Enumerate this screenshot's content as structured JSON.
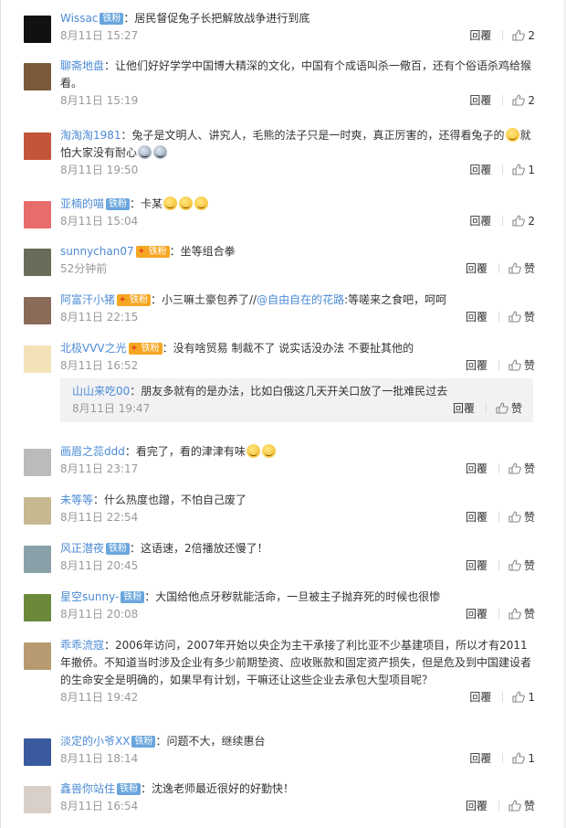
{
  "reply_label": "回覆",
  "comments": [
    {
      "user": "Wissac",
      "badge": "铁粉",
      "vip": "",
      "text": "：居民督促兔子长把解放战争进行到底",
      "time": "8月11日 15:27",
      "likes": "2",
      "avatar": "#111111",
      "emoji": "",
      "emoji_type": "",
      "text2": ""
    },
    {
      "user": "聊斋地盘",
      "badge": "",
      "vip": "",
      "text": "：让他们好好学学中国博大精深的文化，中国有个成语叫杀一儆百，还有个俗语杀鸡给猴看。",
      "time": "8月11日 15:19",
      "likes": "2",
      "avatar": "#7a5a3a",
      "emoji": "",
      "emoji_type": "",
      "text2": ""
    },
    {
      "user": "淘淘淘1981",
      "badge": "",
      "vip": "",
      "text": "：兔子是文明人、讲究人，毛熊的法子只是一时爽，真正厉害的，还得看兔子的",
      "time": "8月11日 19:50",
      "likes": "1",
      "avatar": "#c2553a",
      "emoji": "😊",
      "emoji_type": "smile",
      "text2": "就怕大家没有耐心",
      "emoji2": "😱😱"
    },
    {
      "user": "亚楠的喵",
      "badge": "铁粉",
      "vip": "",
      "text": "：卡某",
      "time": "8月11日 15:04",
      "likes": "2",
      "avatar": "#e86c6c",
      "emoji": "😊😊😊",
      "emoji_type": "smile",
      "text2": ""
    },
    {
      "user": "sunnychan07",
      "badge": "",
      "vip": "铁粉",
      "text": "：坐等组合拳",
      "time": "52分钟前",
      "likes": "",
      "avatar": "#6b6b5a",
      "emoji": "",
      "emoji_type": "",
      "text2": ""
    },
    {
      "user": "阿富汗小猪",
      "badge": "",
      "vip": "铁粉",
      "text": "：小三嘛土豪包养了//",
      "mention": "@自由自在的花路",
      "text_after": ":等嗟来之食吧，呵呵",
      "time": "8月11日 22:15",
      "likes": "",
      "avatar": "#8a6a58",
      "emoji": "",
      "emoji_type": "",
      "text2": ""
    },
    {
      "user": "北极VVV之光",
      "badge": "",
      "vip": "铁粉",
      "text": "：没有啥贸易 制裁不了 说实话没办法 不要扯其他的",
      "time": "8月11日 16:52",
      "likes": "",
      "avatar": "#f3e2b8",
      "emoji": "",
      "emoji_type": "",
      "text2": ""
    }
  ],
  "sub_reply": {
    "user": "山山来吃00",
    "text": "：朋友多就有的是办法，比如白俄这几天开关口放了一批难民过去",
    "time": "8月11日 19:47",
    "likes": ""
  },
  "comments2": [
    {
      "user": "画眉之蕊ddd",
      "badge": "",
      "vip": "",
      "text": "：看完了，看的津津有味",
      "time": "8月11日 23:17",
      "likes": "",
      "avatar": "#bbbbbb",
      "emoji": "😆😆",
      "emoji_type": "laugh",
      "text2": ""
    },
    {
      "user": "未等等",
      "badge": "",
      "vip": "",
      "text": "：什么热度也蹭，不怕自己废了",
      "time": "8月11日 22:54",
      "likes": "",
      "avatar": "#c8b890",
      "emoji": "",
      "emoji_type": "",
      "text2": ""
    },
    {
      "user": "风正潜夜",
      "badge": "铁粉",
      "vip": "",
      "text": "：这语速，2倍播放还慢了！",
      "time": "8月11日 20:45",
      "likes": "",
      "avatar": "#8aa0a8",
      "emoji": "",
      "emoji_type": "",
      "text2": ""
    },
    {
      "user": "星空sunny-",
      "badge": "铁粉",
      "vip": "",
      "text": "：大国给他点牙秽就能活命，一旦被主子抛弃死的时候也很惨",
      "time": "8月11日 20:08",
      "likes": "",
      "avatar": "#6a8a3a",
      "emoji": "",
      "emoji_type": "",
      "text2": ""
    },
    {
      "user": "乖乖流寇",
      "badge": "",
      "vip": "",
      "text": "：2006年访问，2007年开始以央企为主干承接了利比亚不少基建项目，所以才有2011年撤侨。不知道当时涉及企业有多少前期垫资、应收账款和固定资产损失，但是危及到中国建设者的生命安全是明确的，如果早有计划，干嘛还让这些企业去承包大型项目呢？",
      "time": "8月11日 19:42",
      "likes": "1",
      "avatar": "#b89a70",
      "emoji": "",
      "emoji_type": "",
      "text2": ""
    },
    {
      "user": "淡定的小爷XX",
      "badge": "铁粉",
      "vip": "",
      "text": "：问题不大，继续惠台",
      "time": "8月11日 18:14",
      "likes": "1",
      "avatar": "#3a5aa0",
      "emoji": "",
      "emoji_type": "",
      "text2": ""
    },
    {
      "user": "鑫兽你站住",
      "badge": "铁粉",
      "vip": "",
      "text": "：沈逸老师最近很好的好勤快！",
      "time": "8月11日 16:54",
      "likes": "",
      "avatar": "#d8d0c8",
      "emoji": "",
      "emoji_type": "",
      "text2": ""
    }
  ]
}
